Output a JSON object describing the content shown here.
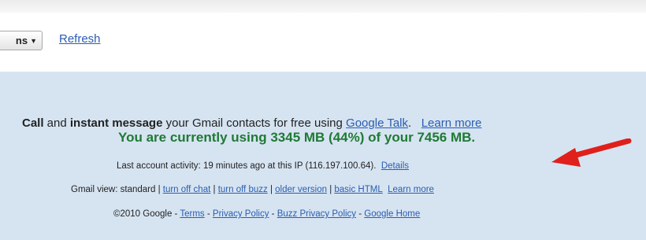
{
  "toolbar": {
    "more_actions_label": "ns",
    "more_actions_caret": "▼",
    "refresh_label": "Refresh"
  },
  "talk": {
    "call": "Call",
    "and": " and ",
    "instant_message": "instant message",
    "rest": " your Gmail contacts for free using ",
    "google_talk_link": "Google Talk",
    "period": ".",
    "learn_more_link": "Learn more"
  },
  "quota": {
    "text": "You are currently using 3345 MB (44%) of your 7456 MB."
  },
  "activity": {
    "text": "Last account activity: 19 minutes ago at this IP (116.197.100.64).",
    "details_link": "Details"
  },
  "view": {
    "prefix": "Gmail view: standard | ",
    "links": [
      "turn off chat",
      "turn off buzz",
      "older version",
      "basic HTML"
    ],
    "separator": " | ",
    "learn_more_link": "Learn more"
  },
  "footer": {
    "copyright": "©2010 Google - ",
    "links": [
      "Terms",
      "Privacy Policy",
      "Buzz Privacy Policy",
      "Google Home"
    ],
    "separator": " - "
  },
  "colors": {
    "panel_background": "#d6e4f2",
    "link": "#2a5db0",
    "quota_text": "#1f7a33",
    "arrow": "#e0201b"
  },
  "annotation": {
    "icon": "red-arrow-icon"
  }
}
